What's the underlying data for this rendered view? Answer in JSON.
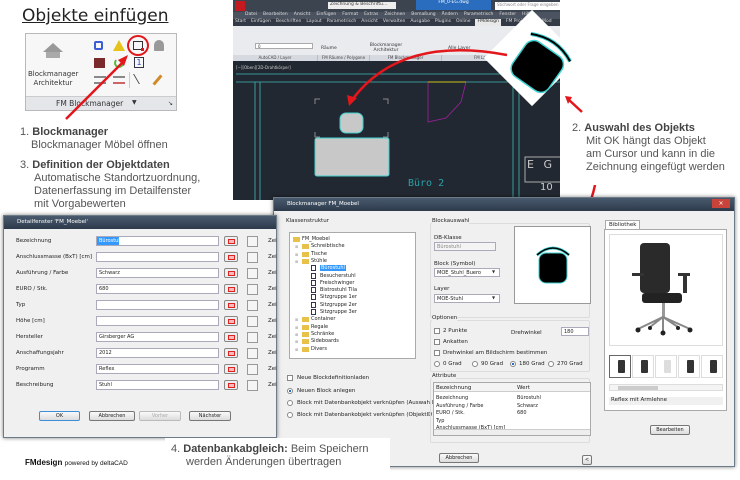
{
  "title": "Objekte einfügen",
  "ribbon_panel": {
    "large_button": "Blockmanager Architektur",
    "panel_label": "FM Blockmanager",
    "highlighted_icon": "blockmanager-moebel-icon"
  },
  "steps": {
    "s1": {
      "num": "1.",
      "title": "Blockmanager",
      "text": "Blockmanager Möbel öffnen"
    },
    "s2": {
      "num": "2.",
      "title": "Auswahl des Objekts",
      "lines": [
        "Mit OK hängt das Objekt",
        "am Cursor und kann in die",
        "Zeichnung eingefügt werden"
      ]
    },
    "s3": {
      "num": "3.",
      "title": "Definition der Objektdaten",
      "lines": [
        "Automatische Standortzuordnung,",
        "Datenerfassung im Detailfenster",
        "mit Vorgabewerten"
      ]
    },
    "s4": {
      "num": "4.",
      "title": "Datenbankabgleich:",
      "text": " Beim Speichern",
      "line2": "werden Änderungen übertragen"
    }
  },
  "footer": {
    "brand": "FMdesign",
    "powered": "powered by deltaCAD"
  },
  "autocad": {
    "doc_title": "FM_0-EG.dwg",
    "workspace": "Zeichnung & Beschriftu...",
    "search_placeholder": "Stichwort oder Frage eingeben",
    "menu": [
      "Datei",
      "Bearbeiten",
      "Ansicht",
      "Einfügen",
      "Format",
      "Extras",
      "Zeichnen",
      "Bemaßung",
      "Ändern",
      "Parametrisch",
      "Fenster",
      "Hilfe"
    ],
    "tabs": [
      "Start",
      "Einfügen",
      "Beschriften",
      "Layout",
      "Parametrisch",
      "Ansicht",
      "Verwalten",
      "Ausgabe",
      "Plugins",
      "Online",
      "FMdesign",
      "FM Project",
      "FM Mod"
    ],
    "active_tab": "FMdesign",
    "groups": [
      "AutoCAD / Layer",
      "FM Räume / Polygone",
      "FM Blockmanager",
      "FM Layer / FM Sichtbarkeit"
    ],
    "buttons": {
      "raeume": "Räume",
      "blockmanager": "Blockmanager Architektur",
      "alle_layer": "Alle Layer"
    },
    "layer_value": "0",
    "viewport_label": "[−][Oben][2D-Drahtkörper]",
    "room_label": "Büro 2",
    "room_tag": "E G",
    "room_num": "10",
    "colors": {
      "background": "#222831",
      "lines": "#3fb8b8",
      "accent": "#e3161b"
    }
  },
  "detail": {
    "title": "Detailfenster 'FM_Moebel'",
    "rows": [
      {
        "label": "Bezeichnung",
        "value": "Bürostuhl"
      },
      {
        "label": "Anschlussmasse (BxT) [cm]",
        "value": ""
      },
      {
        "label": "Ausführung / Farbe",
        "value": "Schwarz"
      },
      {
        "label": "EURO / Stk.",
        "value": "680"
      },
      {
        "label": "Typ",
        "value": ""
      },
      {
        "label": "Höhe [cm]",
        "value": ""
      },
      {
        "label": "Hersteller",
        "value": "Girsberger AG"
      },
      {
        "label": "Anschaffungsjahr",
        "value": "2012"
      },
      {
        "label": "Programm",
        "value": "Reflex"
      },
      {
        "label": "Beschreibung",
        "value": "Stuhl"
      }
    ],
    "side_label": "Zei",
    "buttons": {
      "ok": "OK",
      "cancel": "Abbrechen",
      "prev": "Vorher",
      "next": "Nächster"
    }
  },
  "blockmanager": {
    "title": "Blockmanager FM_Moebel",
    "tree_label": "Klassenstruktur",
    "tree": [
      {
        "label": "FM_Moebel",
        "level": 0,
        "type": "folder"
      },
      {
        "label": "Schreibtische",
        "level": 1,
        "type": "folder"
      },
      {
        "label": "Tische",
        "level": 1,
        "type": "folder"
      },
      {
        "label": "Stühle",
        "level": 1,
        "type": "folder"
      },
      {
        "label": "Bürostuhl",
        "level": 2,
        "type": "block",
        "selected": true
      },
      {
        "label": "Besucherstuhl",
        "level": 2,
        "type": "block"
      },
      {
        "label": "Freischwinger",
        "level": 2,
        "type": "block"
      },
      {
        "label": "Bistrostuhl Tila",
        "level": 2,
        "type": "block"
      },
      {
        "label": "Sitzgruppe 1er",
        "level": 2,
        "type": "block"
      },
      {
        "label": "Sitzgruppe 2er",
        "level": 2,
        "type": "block"
      },
      {
        "label": "Sitzgruppe 3er",
        "level": 2,
        "type": "block"
      },
      {
        "label": "Container",
        "level": 1,
        "type": "folder"
      },
      {
        "label": "Regale",
        "level": 1,
        "type": "folder"
      },
      {
        "label": "Schränke",
        "level": 1,
        "type": "folder"
      },
      {
        "label": "Sideboards",
        "level": 1,
        "type": "folder"
      },
      {
        "label": "Divers",
        "level": 1,
        "type": "folder"
      }
    ],
    "new_def": "Neue Blockdefinitionladen",
    "modes": [
      "Neuen Block anlegen",
      "Block mit Datenbankobjekt verknüpfen (Auswahlliste)",
      "Block mit Datenbankobjekt verknüpfen (ObjektID)"
    ],
    "mode_selected": 0,
    "blockauswahl": "Blockauswahl",
    "db_klasse_label": "DB-Klasse",
    "db_klasse": "Bürostuhl",
    "block_label": "Block (Symbol)",
    "block": "MOE_Stuhl_Buero",
    "layer_label": "Layer",
    "layer": "MOE-Stuhl",
    "optionen": "Optionen",
    "opt_2punkte": "2 Punkte",
    "opt_ankatten": "Ankatten",
    "opt_drehwinkel_screen": "Drehwinkel am Bildschirm bestimmen",
    "drehwinkel_label": "Drehwinkel",
    "drehwinkel": "180",
    "angles": [
      "0 Grad",
      "90 Grad",
      "180 Grad",
      "270 Grad"
    ],
    "angle_selected": 2,
    "attribute": "Attribute",
    "attr_headers": [
      "Bezeichnung",
      "Wert"
    ],
    "attr_rows": [
      [
        "Bezeichnung",
        "Bürostuhl"
      ],
      [
        "Ausführung / Farbe",
        "Schwarz"
      ],
      [
        "EURO / Stk.",
        "680"
      ],
      [
        "Typ",
        ""
      ],
      [
        "Anschlussmasse (BxT) [cm]",
        ""
      ]
    ],
    "cancel": "Abbrechen",
    "collapse": "<",
    "library_tab": "Bibliothek",
    "library_caption": "Reflex mit Armlehne",
    "edit": "Bearbeiten"
  }
}
